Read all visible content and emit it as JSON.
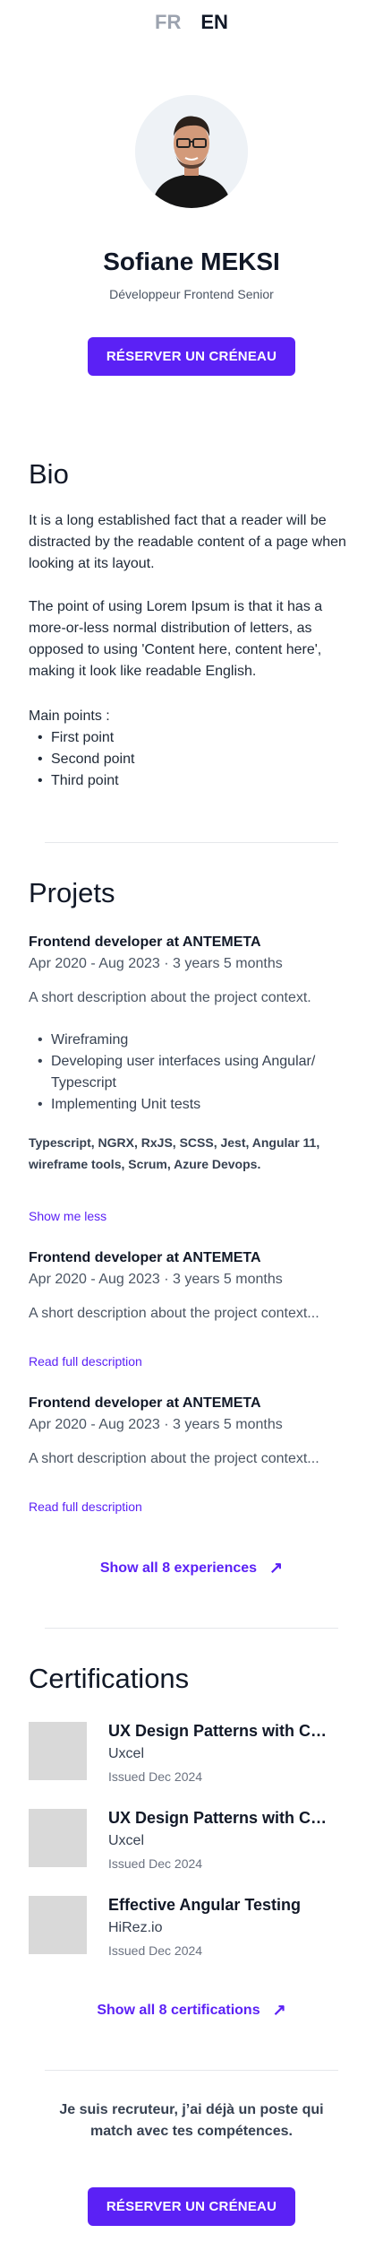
{
  "lang": {
    "fr": "FR",
    "en": "EN"
  },
  "profile": {
    "name": "Sofiane MEKSI",
    "role": "Développeur Frontend Senior",
    "cta": "RÉSERVER UN CRÉNEAU"
  },
  "bio": {
    "title": "Bio",
    "p1": "It is a long established fact that a reader will be distracted by the readable content of a page when looking at its layout.",
    "p2": "The point of using Lorem Ipsum is that it has a more-or-less normal distribution of letters, as opposed to using 'Content here, content here', making it look like readable English.",
    "main_label": "Main points :",
    "points": [
      "First point",
      "Second point",
      "Third point"
    ]
  },
  "projects": {
    "title": "Projets",
    "items": [
      {
        "title": "Frontend developer at ANTEMETA",
        "dates": "Apr 2020 - Aug 2023 · 3 years 5 months",
        "desc": "A short description about the project context.",
        "bullets": [
          "Wireframing",
          "Developing user interfaces using Angular/ Typescript",
          "Implementing Unit tests"
        ],
        "tags": "Typescript, NGRX, RxJS, SCSS, Jest, Angular 11, wireframe tools, Scrum, Azure Devops.",
        "link": "Show me less"
      },
      {
        "title": "Frontend developer at ANTEMETA",
        "dates": "Apr 2020 - Aug 2023 · 3 years 5 months",
        "desc": "A short description about the project context...",
        "link": "Read full description"
      },
      {
        "title": "Frontend developer at ANTEMETA",
        "dates": "Apr 2020 - Aug 2023 · 3 years 5 months",
        "desc": "A short description about the project context...",
        "link": "Read full description"
      }
    ],
    "show_all": "Show all 8 experiences"
  },
  "certifications": {
    "title": "Certifications",
    "items": [
      {
        "title": "UX Design Patterns with Che...",
        "org": "Uxcel",
        "date": "Issued Dec 2024"
      },
      {
        "title": " UX Design Patterns with Che...",
        "org": "Uxcel",
        "date": "Issued Dec 2024"
      },
      {
        "title": "Effective Angular Testing",
        "org": "HiRez.io",
        "date": "Issued Dec 2024"
      }
    ],
    "show_all": "Show all 8 certifications"
  },
  "recruiter": {
    "text": "Je suis recruteur, j’ai déjà un poste qui match avec tes compétences.",
    "cta": "RÉSERVER UN CRÉNEAU"
  },
  "icons": {
    "arrow": "arrow-up-right-icon"
  },
  "colors": {
    "accent": "#5b21f5",
    "text": "#111827",
    "muted": "#4b5563"
  }
}
